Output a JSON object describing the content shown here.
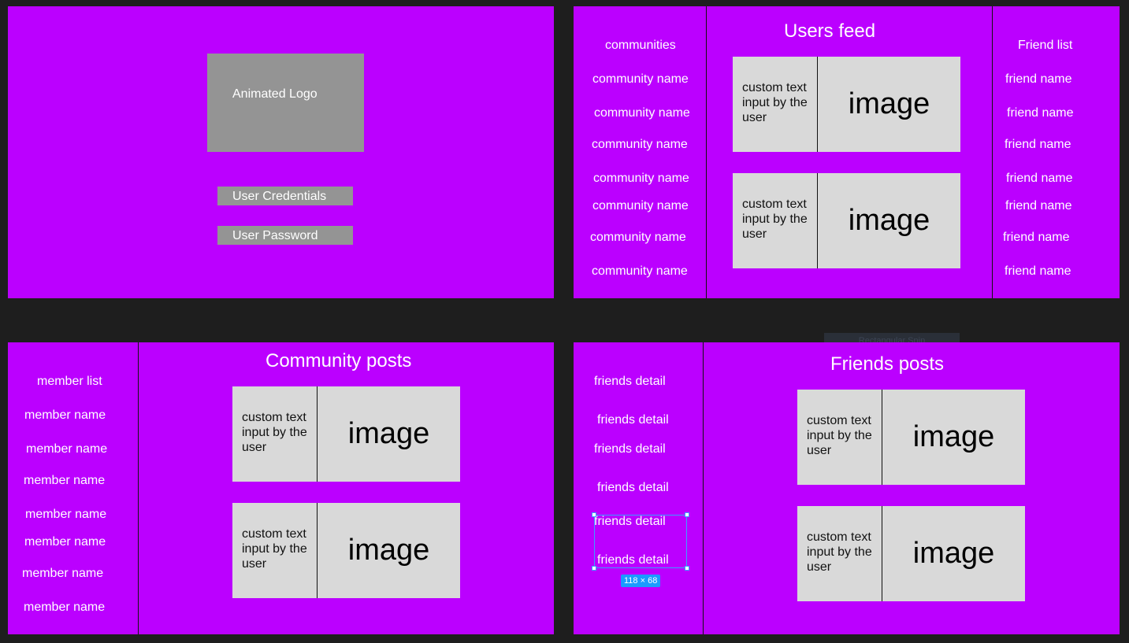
{
  "login": {
    "logo_label": "Animated Logo",
    "credentials_label": "User Credentials",
    "password_label": "User Password"
  },
  "users_feed": {
    "title": "Users feed",
    "communities_header": "communities",
    "communities": [
      "community name",
      "community name",
      "community name",
      "community name",
      "community name",
      "community name",
      "community name"
    ],
    "friends_header": "Friend list",
    "friends": [
      "friend name",
      "friend name",
      "friend name",
      "friend name",
      "friend name",
      "friend name",
      "friend name"
    ],
    "posts": [
      {
        "text": "custom text input by the user",
        "image": "image"
      },
      {
        "text": "custom text input by the user",
        "image": "image"
      }
    ]
  },
  "community_posts": {
    "title": "Community posts",
    "members_header": "member list",
    "members": [
      "member name",
      "member name",
      "member name",
      "member name",
      "member name",
      "member name",
      "member name"
    ],
    "posts": [
      {
        "text": "custom text input by the user",
        "image": "image"
      },
      {
        "text": "custom text input by the user",
        "image": "image"
      }
    ]
  },
  "friends_posts": {
    "title": "Friends posts",
    "details": [
      "friends detail",
      "friends detail",
      "friends detail",
      "friends detail",
      "friends detail",
      "friends detail"
    ],
    "posts": [
      {
        "text": "custom text input by the user",
        "image": "image"
      },
      {
        "text": "custom text input by the user",
        "image": "image"
      }
    ]
  },
  "editor": {
    "selection_size": "118 × 68",
    "ghost_label": "Rectangular Snip"
  },
  "colors": {
    "frame_bg": "#bb00ff",
    "canvas_bg": "#1e1e1e",
    "post_bg": "#d9d9d9",
    "logo_bg": "#949494",
    "selection": "#1a9bff"
  }
}
